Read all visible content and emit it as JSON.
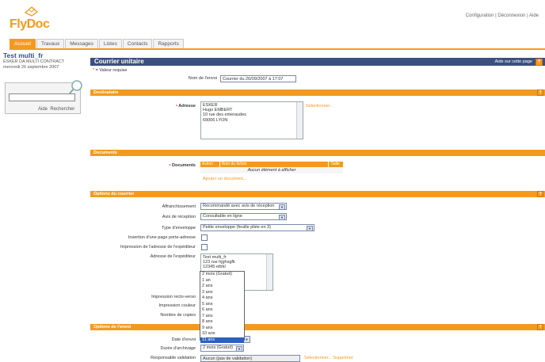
{
  "app": {
    "logo_text": "FlyDoc"
  },
  "header": {
    "links": [
      "Configuration",
      "Déconnexion",
      "Aide"
    ],
    "sep": "|"
  },
  "tabs": [
    "Accueil",
    "Travaux",
    "Messages",
    "Listes",
    "Contacts",
    "Rapports"
  ],
  "sidebar": {
    "title": "Test multi_fr",
    "subtitle": "ESKER DA MULTI CONTRACT",
    "date": "mercredi 26 septembre 2007",
    "search_value": "",
    "help_link": "Aide",
    "search_link": "Rechercher"
  },
  "main": {
    "title": "Courrier unitaire",
    "help_link": "Aide sur cette page",
    "required_note": "= Valeur requise",
    "sender_name_label": "Nom de l'envoi",
    "sender_name_value": "Courrier du 26/09/2007 à 17:07"
  },
  "recipient": {
    "section": "Destinataire",
    "address_label": "Adresse",
    "address_lines": [
      "ESKER",
      "Hugo EMBERT",
      "10 rue des emeraudes",
      "69006 LYON"
    ],
    "select_link": "Sélectionner..."
  },
  "documents": {
    "section": "Documents",
    "label": "Documents",
    "columns": [
      "Action",
      "Nom du fichier",
      "Taille"
    ],
    "empty": "Aucun élément à afficher",
    "add_link": "Ajouter un document..."
  },
  "options_courrier": {
    "section": "Options du courrier",
    "affranchissement_label": "Affranchissement",
    "affranchissement_value": "Recommandé avec avis de réception",
    "avis_label": "Avis de réception",
    "avis_value": "Consultable en ligne",
    "enveloppe_label": "Type d'enveloppe",
    "enveloppe_value": "Petite enveloppe (feuille pliée en 3)",
    "porte_adresse_label": "Insertion d'une page porte-adresse",
    "impression_exp_label": "Impression de l'adresse de l'expéditeur",
    "adresse_exp_label": "Adresse de l'expéditeur",
    "adresse_exp_lines": [
      "Test multi_fr",
      "123 rue hjghsgfk",
      "12345 ettrkl"
    ],
    "recto_verso_label": "Impression recto-verso",
    "couleur_label": "Impression couleur",
    "copies_label": "Nombre de copies"
  },
  "options_envoi": {
    "section": "Options de l'envoi",
    "date_label": "Date d'envoi",
    "archivage_label": "Durée d'archivage",
    "archivage_value": "2 mois (Gratuit)",
    "validation_label": "Responsable validation",
    "validation_value": "Aucun (pas de validation)",
    "validation_links": "Sélectionner...  Supprimer"
  },
  "dropdown": {
    "options": [
      "2 mois (Gratuit)",
      "1 an",
      "2 ans",
      "3 ans",
      "4 ans",
      "5 ans",
      "6 ans",
      "7 ans",
      "8 ans",
      "9 ans",
      "10 ans",
      "11 ans"
    ],
    "highlighted_index": 11
  },
  "colors": {
    "accent": "#f39a1e",
    "header_blue": "#3b4f80",
    "highlight": "#2a5fc4"
  }
}
